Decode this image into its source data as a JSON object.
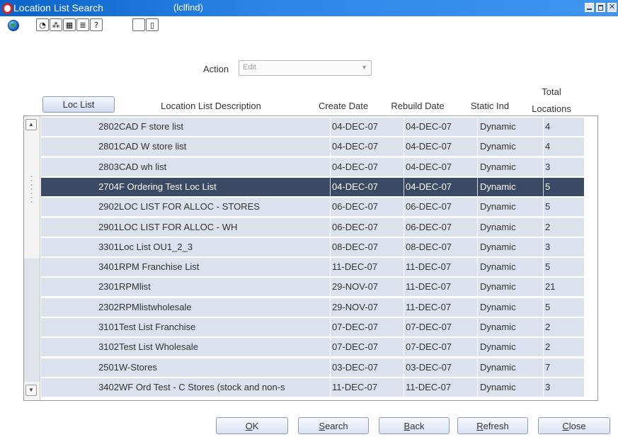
{
  "window": {
    "title": "Location List Search",
    "code": "(lclfind)"
  },
  "toolbar": {
    "icons": [
      "globe-icon",
      "help-circle-icon",
      "find-icon",
      "calendar-icon",
      "notes-icon",
      "question-icon",
      "blank-icon",
      "new-document-icon"
    ]
  },
  "action": {
    "label": "Action",
    "value": "Edit"
  },
  "table": {
    "loc_list_button": "Loc List",
    "headers": {
      "description": "Location List Description",
      "create_date": "Create Date",
      "rebuild_date": "Rebuild Date",
      "static_ind": "Static Ind",
      "total_locations_line1": "Total",
      "total_locations_line2": "Locations"
    },
    "selected_index": 3,
    "rows": [
      {
        "id": "2802",
        "desc": "CAD F store list",
        "create": "04-DEC-07",
        "rebuild": "04-DEC-07",
        "static": "Dynamic",
        "total": "4"
      },
      {
        "id": "2801",
        "desc": "CAD W store list",
        "create": "04-DEC-07",
        "rebuild": "04-DEC-07",
        "static": "Dynamic",
        "total": "4"
      },
      {
        "id": "2803",
        "desc": "CAD wh list",
        "create": "04-DEC-07",
        "rebuild": "04-DEC-07",
        "static": "Dynamic",
        "total": "3"
      },
      {
        "id": "2704",
        "desc": "F Ordering Test Loc List",
        "create": "04-DEC-07",
        "rebuild": "04-DEC-07",
        "static": "Dynamic",
        "total": "5"
      },
      {
        "id": "2902",
        "desc": "LOC  LIST FOR ALLOC - STORES",
        "create": "06-DEC-07",
        "rebuild": "06-DEC-07",
        "static": "Dynamic",
        "total": "5"
      },
      {
        "id": "2901",
        "desc": "LOC LIST FOR ALLOC - WH",
        "create": "06-DEC-07",
        "rebuild": "06-DEC-07",
        "static": "Dynamic",
        "total": "2"
      },
      {
        "id": "3301",
        "desc": "Loc List OU1_2_3",
        "create": "08-DEC-07",
        "rebuild": "08-DEC-07",
        "static": "Dynamic",
        "total": "3"
      },
      {
        "id": "3401",
        "desc": "RPM Franchise List",
        "create": "11-DEC-07",
        "rebuild": "11-DEC-07",
        "static": "Dynamic",
        "total": "5"
      },
      {
        "id": "2301",
        "desc": "RPMlist",
        "create": "29-NOV-07",
        "rebuild": "11-DEC-07",
        "static": "Dynamic",
        "total": "21"
      },
      {
        "id": "2302",
        "desc": "RPMlistwholesale",
        "create": "29-NOV-07",
        "rebuild": "11-DEC-07",
        "static": "Dynamic",
        "total": "5"
      },
      {
        "id": "3101",
        "desc": "Test List Franchise",
        "create": "07-DEC-07",
        "rebuild": "07-DEC-07",
        "static": "Dynamic",
        "total": "2"
      },
      {
        "id": "3102",
        "desc": "Test List Wholesale",
        "create": "07-DEC-07",
        "rebuild": "07-DEC-07",
        "static": "Dynamic",
        "total": "2"
      },
      {
        "id": "2501",
        "desc": "W-Stores",
        "create": "03-DEC-07",
        "rebuild": "03-DEC-07",
        "static": "Dynamic",
        "total": "7"
      },
      {
        "id": "3402",
        "desc": "WF Ord Test - C Stores (stock and non-s",
        "create": "11-DEC-07",
        "rebuild": "11-DEC-07",
        "static": "Dynamic",
        "total": "3"
      }
    ]
  },
  "buttons": {
    "ok": {
      "mnemonic": "O",
      "rest": "K"
    },
    "search": {
      "mnemonic": "S",
      "rest": "earch"
    },
    "back": {
      "mnemonic": "B",
      "rest": "ack"
    },
    "refresh": {
      "mnemonic": "R",
      "rest": "efresh"
    },
    "close": {
      "mnemonic": "C",
      "rest": "lose"
    }
  },
  "colors": {
    "titlebar": "#1a73dc",
    "row_bg": "#dce2ed",
    "row_selected": "#3a4964"
  }
}
